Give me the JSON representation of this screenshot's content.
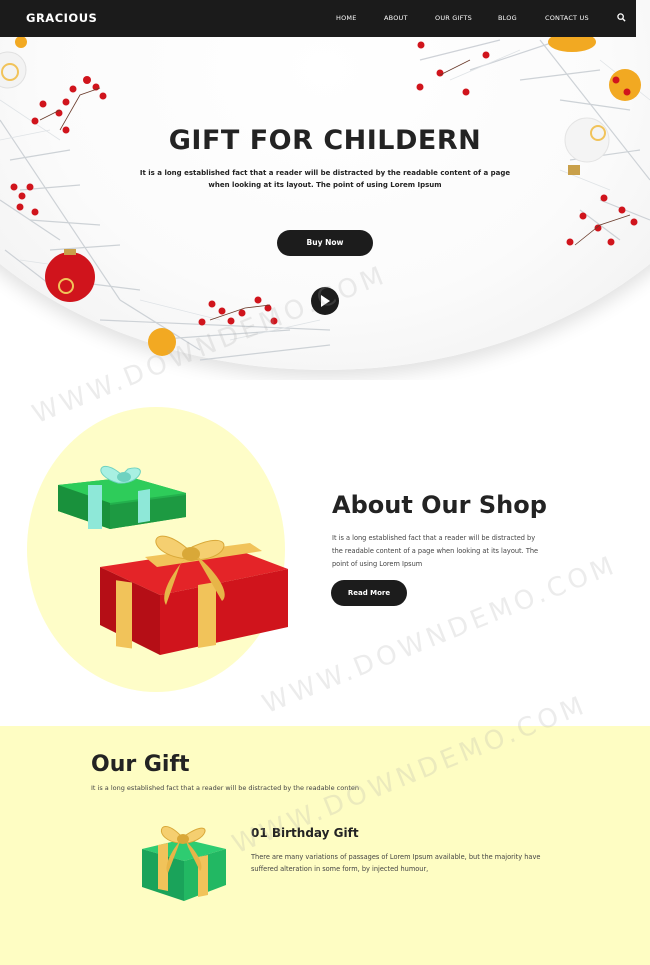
{
  "brand": {
    "logo": "GRACIOUS"
  },
  "nav": {
    "items": [
      {
        "label": "HOME"
      },
      {
        "label": "ABOUT"
      },
      {
        "label": "OUR GIFTS"
      },
      {
        "label": "BLOG"
      },
      {
        "label": "CONTACT US"
      }
    ],
    "search_icon": "search-icon"
  },
  "hero": {
    "title": "GIFT FOR CHILDERN",
    "text": "It is a long established fact that a reader will be distracted by the readable content of a page when looking at its layout. The point of using Lorem Ipsum",
    "button": "Buy Now",
    "play_icon": "play-icon"
  },
  "about": {
    "title": "About Our Shop",
    "text": "It is a long established fact that a reader will be distracted by the readable content of a page when looking at its layout. The point of using Lorem Ipsum",
    "button": "Read More"
  },
  "gifts": {
    "title": "Our Gift",
    "subtitle": "It is a long established fact that a reader will be distracted by the readable conten",
    "items": [
      {
        "title": "01 Birthday Gift",
        "text": "There are many variations of passages of Lorem Ipsum available, but the majority have suffered alteration in some form, by injected humour,"
      }
    ]
  },
  "watermark": {
    "text": "WWW.DOWNDEMO.COM"
  },
  "colors": {
    "nav_bg": "#1b1b1b",
    "button_bg": "#1c1c1c",
    "yellow_bg": "#fefdc3",
    "gift_red": "#d0141c",
    "gift_green": "#1fae4b",
    "ribbon_gold": "#f1c35a"
  }
}
